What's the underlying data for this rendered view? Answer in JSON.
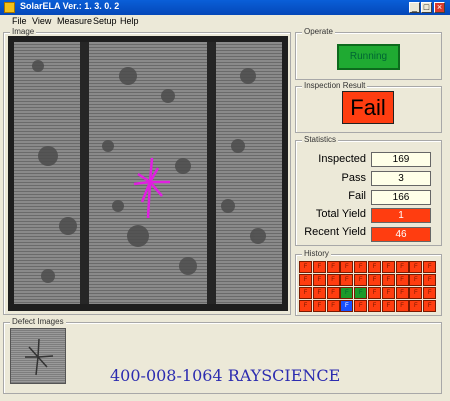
{
  "window": {
    "title": "SolarELA Ver.: 1. 3. 0. 2",
    "min_glyph": "_",
    "max_glyph": "□",
    "close_glyph": "×"
  },
  "menu": [
    "File",
    "View",
    "Measure",
    "Setup",
    "Help"
  ],
  "image_panel": {
    "label": "Image"
  },
  "operate": {
    "label": "Operate",
    "button": "Running",
    "button_color": "#1faa32"
  },
  "inspection": {
    "label": "Inspection Result",
    "result": "Fail",
    "result_color": "#ff3d10"
  },
  "statistics": {
    "label": "Statistics",
    "rows": [
      {
        "label": "Inspected",
        "value": "169",
        "style": "normal"
      },
      {
        "label": "Pass",
        "value": "3",
        "style": "normal"
      },
      {
        "label": "Fail",
        "value": "166",
        "style": "normal"
      },
      {
        "label": "Total Yield",
        "value": "1",
        "style": "red"
      },
      {
        "label": "Recent Yield",
        "value": "46",
        "style": "red"
      }
    ]
  },
  "history": {
    "label": "History",
    "cell_text": "F",
    "rows": [
      [
        "fail",
        "fail",
        "fail",
        "fail",
        "fail",
        "fail",
        "fail",
        "fail",
        "fail",
        "fail"
      ],
      [
        "fail",
        "fail",
        "fail",
        "fail",
        "fail",
        "fail",
        "fail",
        "fail",
        "fail",
        "fail"
      ],
      [
        "fail",
        "fail",
        "fail",
        "pass",
        "pass",
        "fail",
        "fail",
        "fail",
        "fail",
        "fail"
      ],
      [
        "fail",
        "fail",
        "fail",
        "current",
        "fail",
        "fail",
        "fail",
        "fail",
        "fail",
        "fail"
      ]
    ]
  },
  "defect_images": {
    "label": "Defect Images"
  },
  "watermark": "400-008-1064 RAYSCIENCE"
}
